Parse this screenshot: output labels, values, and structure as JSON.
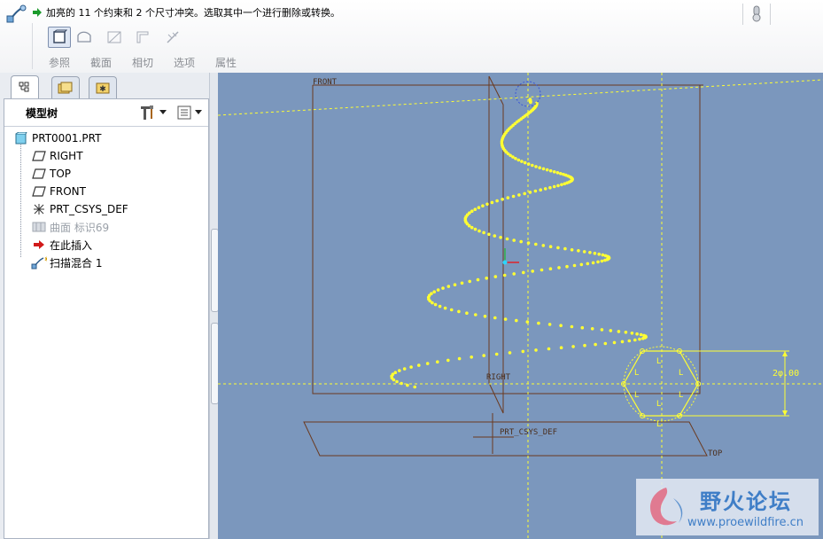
{
  "dashboard": {
    "message": "加亮的 11 个约束和 2 个尺寸冲突。选取其中一个进行删除或转换。",
    "tools": [
      {
        "icon": "solid-icon",
        "active": true
      },
      {
        "icon": "surface-icon",
        "active": false
      },
      {
        "icon": "cut-icon",
        "active": false
      },
      {
        "icon": "thicken-icon",
        "active": false
      },
      {
        "icon": "slash-icon",
        "active": false
      }
    ],
    "tabs": [
      "参照",
      "截面",
      "相切",
      "选项",
      "属性"
    ]
  },
  "model_tree": {
    "title": "模型树",
    "items": [
      {
        "label": "PRT0001.PRT",
        "icon": "part-icon"
      },
      {
        "label": "RIGHT",
        "icon": "datum-plane-icon"
      },
      {
        "label": "TOP",
        "icon": "datum-plane-icon"
      },
      {
        "label": "FRONT",
        "icon": "datum-plane-icon"
      },
      {
        "label": "PRT_CSYS_DEF",
        "icon": "csys-icon"
      },
      {
        "label": "曲面 标识69",
        "icon": "surface-feature-icon"
      },
      {
        "label": "在此插入",
        "icon": "insert-here-arrow-icon"
      },
      {
        "label": "扫描混合 1",
        "icon": "sweep-blend-icon"
      }
    ]
  },
  "viewport": {
    "front_label": "FRONT",
    "right_label": "RIGHT",
    "top_label": "TOP",
    "csys_label": "PRT_CSYS_DEF",
    "dimension": "2φ.00",
    "constraint_label": "L",
    "colors": {
      "background": "#7b97bd",
      "curve": "#ffff33",
      "datum": "#6b3a1f"
    }
  },
  "watermark": {
    "title": "野火论坛",
    "url": "www.proewildfire.cn"
  }
}
